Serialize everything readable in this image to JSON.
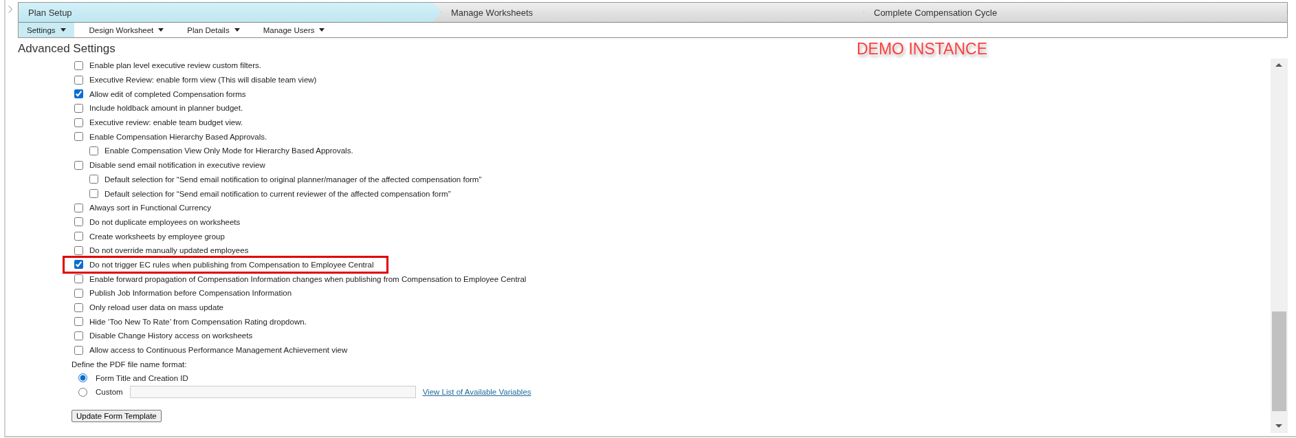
{
  "steps": [
    {
      "label": "Plan Setup",
      "selected": true
    },
    {
      "label": "Manage Worksheets",
      "selected": false
    },
    {
      "label": "Complete Compensation Cycle",
      "selected": false
    }
  ],
  "subtabs": [
    {
      "label": "Settings",
      "selected": true
    },
    {
      "label": "Design Worksheet",
      "selected": false
    },
    {
      "label": "Plan Details",
      "selected": false
    },
    {
      "label": "Manage Users",
      "selected": false
    }
  ],
  "page_title": "Advanced Settings",
  "demo_label": "DEMO INSTANCE",
  "options": [
    {
      "label": "Enable plan level executive review custom filters.",
      "checked": false,
      "highlighted": false
    },
    {
      "label": "Executive Review: enable form view (This will disable team view)",
      "checked": false,
      "highlighted": false
    },
    {
      "label": "Allow edit of completed Compensation forms",
      "checked": true,
      "highlighted": false
    },
    {
      "label": "Include holdback amount in planner budget.",
      "checked": false,
      "highlighted": false
    },
    {
      "label": "Executive review: enable team budget view.",
      "checked": false,
      "highlighted": false
    },
    {
      "label": "Enable Compensation Hierarchy Based Approvals.",
      "checked": false,
      "highlighted": false,
      "children": [
        {
          "label": "Enable Compensation View Only Mode for Hierarchy Based Approvals.",
          "checked": false,
          "highlighted": false
        }
      ]
    },
    {
      "label": "Disable send email notification in executive review",
      "checked": false,
      "highlighted": false,
      "children": [
        {
          "label": "Default selection for “Send email notification to original planner/manager of the affected compensation form”",
          "checked": false,
          "highlighted": false
        },
        {
          "label": "Default selection for “Send email notification to current reviewer of the affected compensation form”",
          "checked": false,
          "highlighted": false
        }
      ]
    },
    {
      "label": "Always sort in Functional Currency",
      "checked": false,
      "highlighted": false
    },
    {
      "label": "Do not duplicate employees on worksheets",
      "checked": false,
      "highlighted": false
    },
    {
      "label": "Create worksheets by employee group",
      "checked": false,
      "highlighted": false
    },
    {
      "label": "Do not override manually updated employees",
      "checked": false,
      "highlighted": false
    },
    {
      "label": "Do not trigger EC rules when publishing from Compensation to Employee Central",
      "checked": true,
      "highlighted": true
    },
    {
      "label": "Enable forward propagation of Compensation Information changes when publishing from Compensation to Employee Central",
      "checked": false,
      "highlighted": false
    },
    {
      "label": "Publish Job Information before Compensation Information",
      "checked": false,
      "highlighted": false
    },
    {
      "label": "Only reload user data on mass update",
      "checked": false,
      "highlighted": false
    },
    {
      "label": "Hide ‘Too New To Rate’ from Compensation Rating dropdown.",
      "checked": false,
      "highlighted": false
    },
    {
      "label": "Disable Change History access on worksheets",
      "checked": false,
      "highlighted": false
    },
    {
      "label": "Allow access to Continuous Performance Management Achievement view",
      "checked": false,
      "highlighted": false
    }
  ],
  "pdf_format": {
    "label": "Define the PDF file name format:",
    "choices": [
      {
        "label": "Form Title and Creation ID",
        "selected": true
      },
      {
        "label": "Custom",
        "selected": false,
        "has_field": true
      }
    ],
    "link": "View List of Available Variables"
  },
  "button": "Update Form Template"
}
